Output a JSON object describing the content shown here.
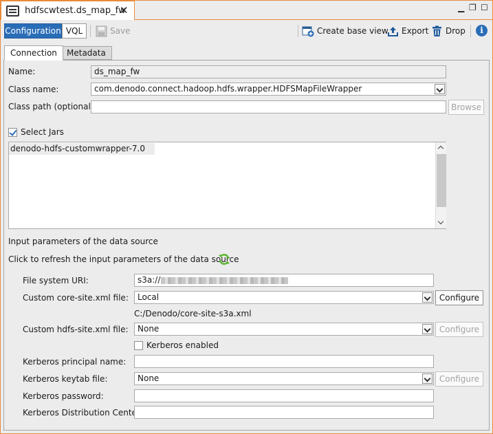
{
  "window": {
    "title": "hdfscwtest.ds_map_fw"
  },
  "toolbar": {
    "configuration": "Configuration",
    "vql": "VQL",
    "save": "Save",
    "create_base_view": "Create base view",
    "export": "Export",
    "drop": "Drop"
  },
  "tabs": {
    "connection": "Connection",
    "metadata": "Metadata"
  },
  "form": {
    "name_label": "Name:",
    "name_value": "ds_map_fw",
    "class_name_label": "Class name:",
    "class_name_value": "com.denodo.connect.hadoop.hdfs.wrapper.HDFSMapFileWrapper",
    "class_path_label": "Class path (optional):",
    "class_path_value": "",
    "browse": "Browse",
    "select_jars_label": "Select Jars",
    "select_jars_checked": true,
    "jars": [
      "denodo-hdfs-customwrapper-7.0"
    ],
    "input_params_heading": "Input parameters of the data source",
    "refresh_text": "Click to refresh the input parameters of the data source",
    "fs_uri_label": "File system URI:",
    "fs_uri_value": "s3a://",
    "core_site_label": "Custom core-site.xml file:",
    "core_site_value": "Local",
    "core_site_configure": "Configure",
    "core_site_path": "C:/Denodo/core-site-s3a.xml",
    "hdfs_site_label": "Custom hdfs-site.xml file:",
    "hdfs_site_value": "None",
    "hdfs_site_configure": "Configure",
    "kerberos_enabled_label": "Kerberos enabled",
    "kerberos_enabled_checked": false,
    "kerberos_principal_label": "Kerberos principal name:",
    "kerberos_keytab_label": "Kerberos keytab file:",
    "kerberos_keytab_value": "None",
    "kerberos_keytab_configure": "Configure",
    "kerberos_password_label": "Kerberos password:",
    "kerberos_kdc_label": "Kerberos Distribution Center:"
  },
  "colors": {
    "accent": "#2a6db7",
    "border_active": "#e88a3c",
    "refresh_green": "#5cb531"
  }
}
